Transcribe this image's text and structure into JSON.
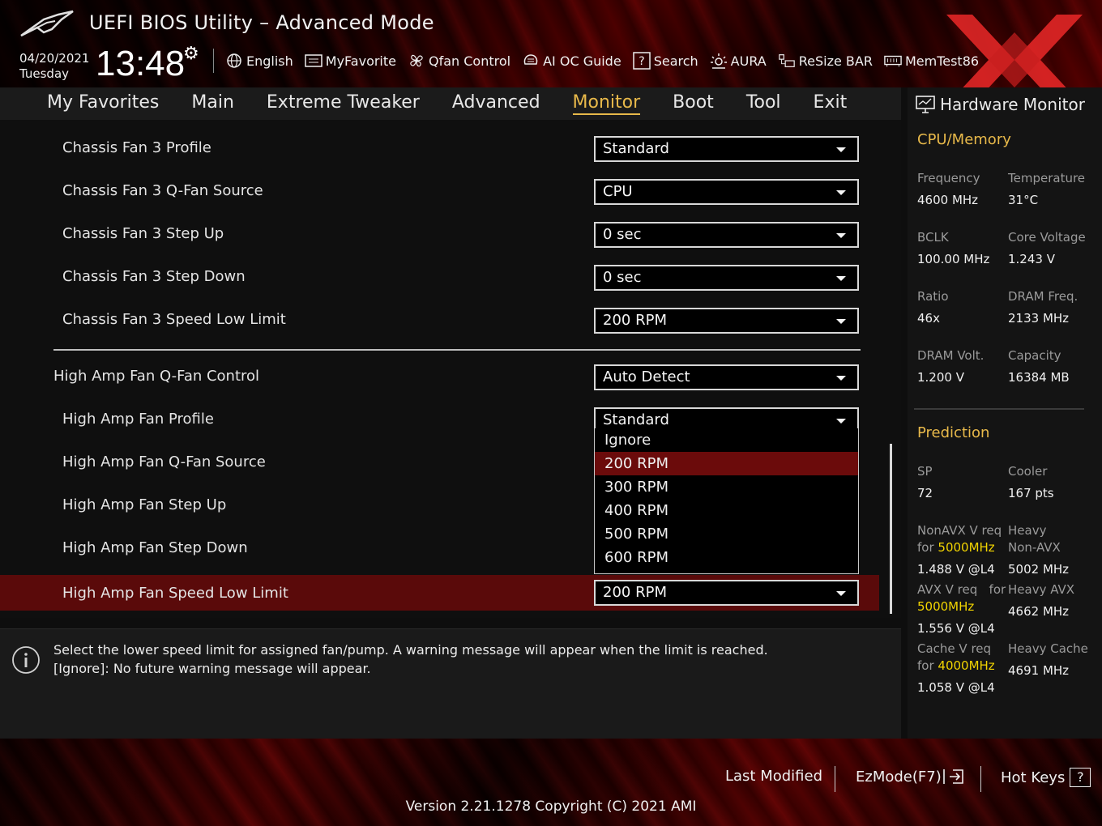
{
  "app": {
    "title": "UEFI BIOS Utility – Advanced Mode",
    "date": "04/20/2021",
    "day": "Tuesday",
    "time": "13:48"
  },
  "toolbar": [
    {
      "label": "English",
      "icon": "globe-icon"
    },
    {
      "label": "MyFavorite",
      "icon": "favorite-icon"
    },
    {
      "label": "Qfan Control",
      "icon": "fan-icon"
    },
    {
      "label": "AI OC Guide",
      "icon": "ai-oc-icon"
    },
    {
      "label": "Search",
      "icon": "search-icon"
    },
    {
      "label": "AURA",
      "icon": "aura-icon"
    },
    {
      "label": "ReSize BAR",
      "icon": "resize-bar-icon"
    },
    {
      "label": "MemTest86",
      "icon": "memtest-icon"
    }
  ],
  "nav": [
    "My Favorites",
    "Main",
    "Extreme Tweaker",
    "Advanced",
    "Monitor",
    "Boot",
    "Tool",
    "Exit"
  ],
  "nav_active": "Monitor",
  "settings": [
    {
      "label": "Chassis Fan 3 Profile",
      "value": "Standard"
    },
    {
      "label": "Chassis Fan 3 Q-Fan Source",
      "value": "CPU"
    },
    {
      "label": "Chassis Fan 3 Step Up",
      "value": "0 sec"
    },
    {
      "label": "Chassis Fan 3 Step Down",
      "value": "0 sec"
    },
    {
      "label": "Chassis Fan 3 Speed Low Limit",
      "value": "200 RPM"
    },
    {
      "label": "High Amp Fan Q-Fan Control",
      "value": "Auto Detect"
    },
    {
      "label": "High Amp Fan Profile",
      "value": "Standard"
    },
    {
      "label": "High Amp Fan Q-Fan Source",
      "value": ""
    },
    {
      "label": "High Amp Fan Step Up",
      "value": ""
    },
    {
      "label": "High Amp Fan Step Down",
      "value": ""
    },
    {
      "label": "High Amp Fan Speed Low Limit",
      "value": "200 RPM"
    }
  ],
  "dropdown": {
    "options": [
      "Ignore",
      "200 RPM",
      "300 RPM",
      "400 RPM",
      "500 RPM",
      "600 RPM"
    ],
    "highlighted": "200 RPM"
  },
  "help": {
    "line1": "Select the lower speed limit for assigned fan/pump. A warning message will appear when the limit is reached.",
    "line2": "[Ignore]: No future warning message will appear."
  },
  "hwmon": {
    "title": "Hardware Monitor",
    "cpu_section": "CPU/Memory",
    "frequency_label": "Frequency",
    "frequency": "4600 MHz",
    "temperature_label": "Temperature",
    "temperature": "31°C",
    "bclk_label": "BCLK",
    "bclk": "100.00 MHz",
    "core_voltage_label": "Core Voltage",
    "core_voltage": "1.243 V",
    "ratio_label": "Ratio",
    "ratio": "46x",
    "dram_freq_label": "DRAM Freq.",
    "dram_freq": "2133 MHz",
    "dram_volt_label": "DRAM Volt.",
    "dram_volt": "1.200 V",
    "capacity_label": "Capacity",
    "capacity": "16384 MB",
    "prediction_section": "Prediction",
    "sp_label": "SP",
    "sp": "72",
    "cooler_label": "Cooler",
    "cooler": "167 pts",
    "nonavx_label": "NonAVX V req",
    "for_word": "for",
    "nonavx_freq": "5000MHz",
    "nonavx_v": "1.488 V @L4",
    "heavy_nonavx_label_1": "Heavy",
    "heavy_nonavx_label_2": "Non-AVX",
    "heavy_nonavx": "5002 MHz",
    "avx_label": "AVX V req",
    "avx_for": "for",
    "avx_freq": "5000MHz",
    "avx_v": "1.556 V @L4",
    "heavy_avx_label": "Heavy AVX",
    "heavy_avx": "4662 MHz",
    "cache_label": "Cache V req",
    "cache_freq": "4000MHz",
    "cache_v": "1.058 V @L4",
    "heavy_cache_label": "Heavy Cache",
    "heavy_cache": "4691 MHz"
  },
  "footer": {
    "last_modified": "Last Modified",
    "ezmode": "EzMode(F7)",
    "hotkeys": "Hot Keys",
    "hotkeys_key": "?",
    "version": "Version 2.21.1278 Copyright (C) 2021 AMI"
  },
  "colors": {
    "accent": "#e8b94a",
    "selection": "#5a0a0a",
    "highlight_freq": "#f2d400"
  }
}
